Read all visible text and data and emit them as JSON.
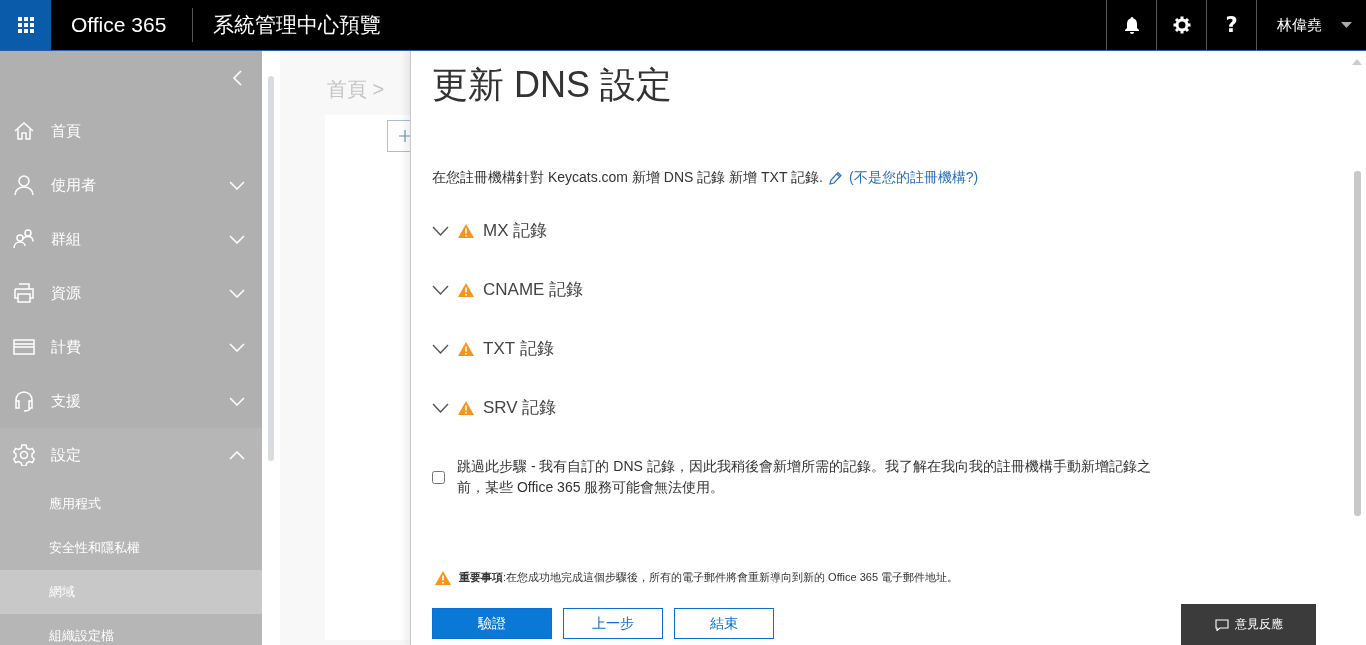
{
  "app_bar": {
    "app_name": "Office 365",
    "title": "系統管理中心預覽",
    "user_name": "林偉堯",
    "help_label": "?"
  },
  "sidebar": {
    "items": [
      {
        "label": "首頁"
      },
      {
        "label": "使用者",
        "expanded": false
      },
      {
        "label": "群組",
        "expanded": false
      },
      {
        "label": "資源",
        "expanded": false
      },
      {
        "label": "計費",
        "expanded": false
      },
      {
        "label": "支援",
        "expanded": false
      },
      {
        "label": "設定",
        "expanded": true,
        "children": [
          {
            "label": "應用程式",
            "selected": false
          },
          {
            "label": "安全性和隱私權",
            "selected": false
          },
          {
            "label": "網域",
            "selected": true
          },
          {
            "label": "組織設定檔",
            "selected": false
          }
        ]
      }
    ]
  },
  "background": {
    "breadcrumb": "首頁 >"
  },
  "panel": {
    "title": "更新 DNS 設定",
    "description": "在您註冊機構針對 Keycats.com 新增 DNS 記錄 新增 TXT 記錄.",
    "description_link": "(不是您的註冊機構?)",
    "sections": [
      {
        "label": "MX 記錄",
        "expanded": false
      },
      {
        "label": "CNAME 記錄",
        "expanded": false
      },
      {
        "label": "TXT 記錄",
        "expanded": false
      },
      {
        "label": "SRV 記錄",
        "expanded": false
      }
    ],
    "skip_checkbox": {
      "label": "跳過此步驟 - 我有自訂的 DNS 記錄，因此我稍後會新增所需的記錄。我了解在我向我的註冊機構手動新增記錄之前，某些 Office 365 服務可能會無法使用。",
      "checked": false
    },
    "notice": "**重要事項**:在您成功地完成這個步驟後，所有的電子郵件將會重新導向到新的 Office 365 電子郵件地址。",
    "buttons": [
      {
        "label": "驗證",
        "kind": "primary"
      },
      {
        "label": "上一步",
        "kind": "secondary"
      },
      {
        "label": "結束",
        "kind": "secondary"
      }
    ]
  },
  "feedback_button": {
    "label": "意見反應"
  }
}
